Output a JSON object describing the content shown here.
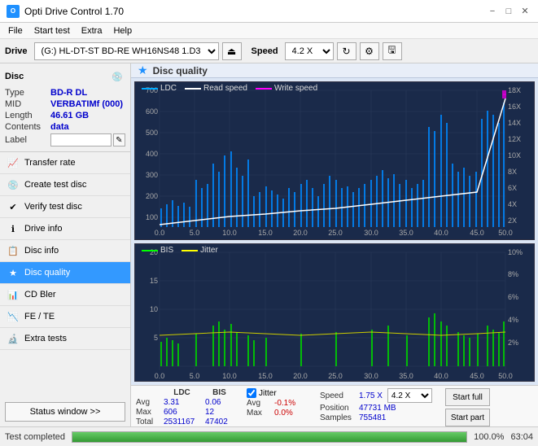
{
  "titlebar": {
    "title": "Opti Drive Control 1.70",
    "icon": "O",
    "minimize": "−",
    "maximize": "□",
    "close": "✕"
  },
  "menubar": {
    "items": [
      "File",
      "Start test",
      "Extra",
      "Help"
    ]
  },
  "drivebar": {
    "label": "Drive",
    "drive_value": "(G:)  HL-DT-ST BD-RE  WH16NS48 1.D3",
    "speed_label": "Speed",
    "speed_value": "4.2 X",
    "eject_icon": "⏏"
  },
  "disc": {
    "title": "Disc",
    "type_label": "Type",
    "type_value": "BD-R DL",
    "mid_label": "MID",
    "mid_value": "VERBATIMf (000)",
    "length_label": "Length",
    "length_value": "46.61 GB",
    "contents_label": "Contents",
    "contents_value": "data",
    "label_label": "Label",
    "label_value": ""
  },
  "nav": {
    "items": [
      {
        "id": "transfer-rate",
        "label": "Transfer rate",
        "icon": "📈"
      },
      {
        "id": "create-test-disc",
        "label": "Create test disc",
        "icon": "💿"
      },
      {
        "id": "verify-test-disc",
        "label": "Verify test disc",
        "icon": "✔"
      },
      {
        "id": "drive-info",
        "label": "Drive info",
        "icon": "ℹ"
      },
      {
        "id": "disc-info",
        "label": "Disc info",
        "icon": "📋"
      },
      {
        "id": "disc-quality",
        "label": "Disc quality",
        "icon": "★",
        "active": true
      },
      {
        "id": "cd-bler",
        "label": "CD Bler",
        "icon": "📊"
      },
      {
        "id": "fe-te",
        "label": "FE / TE",
        "icon": "📉"
      },
      {
        "id": "extra-tests",
        "label": "Extra tests",
        "icon": "🔬"
      }
    ],
    "status_btn": "Status window >>"
  },
  "content": {
    "header": "Disc quality",
    "header_icon": "★"
  },
  "chart_top": {
    "legend": [
      {
        "label": "LDC",
        "color": "#00aaff"
      },
      {
        "label": "Read speed",
        "color": "#ffffff"
      },
      {
        "label": "Write speed",
        "color": "#ff00ff"
      }
    ],
    "y_max": 700,
    "y_min": 0,
    "y_right_max": 18,
    "x_max": 50,
    "y_labels": [
      "700",
      "600",
      "500",
      "400",
      "300",
      "200",
      "100"
    ],
    "y_right_labels": [
      "18X",
      "16X",
      "14X",
      "12X",
      "10X",
      "8X",
      "6X",
      "4X",
      "2X"
    ],
    "x_labels": [
      "0.0",
      "5.0",
      "10.0",
      "15.0",
      "20.0",
      "25.0",
      "30.0",
      "35.0",
      "40.0",
      "45.0",
      "50.0"
    ]
  },
  "chart_bottom": {
    "legend": [
      {
        "label": "BIS",
        "color": "#00ff00"
      },
      {
        "label": "Jitter",
        "color": "#ffff00"
      }
    ],
    "y_max": 20,
    "y_min": 0,
    "y_right_max": 10,
    "x_max": 50,
    "y_labels": [
      "20",
      "15",
      "10",
      "5"
    ],
    "y_right_labels": [
      "10%",
      "8%",
      "6%",
      "4%",
      "2%"
    ],
    "x_labels": [
      "0.0",
      "5.0",
      "10.0",
      "15.0",
      "20.0",
      "25.0",
      "30.0",
      "35.0",
      "40.0",
      "45.0",
      "50.0"
    ]
  },
  "stats": {
    "ldc_label": "LDC",
    "bis_label": "BIS",
    "jitter_label": "Jitter",
    "jitter_checked": true,
    "avg_label": "Avg",
    "avg_ldc": "3.31",
    "avg_bis": "0.06",
    "avg_jitter": "-0.1%",
    "max_label": "Max",
    "max_ldc": "606",
    "max_bis": "12",
    "max_jitter": "0.0%",
    "total_label": "Total",
    "total_ldc": "2531167",
    "total_bis": "47402",
    "speed_label": "Speed",
    "speed_value": "1.75 X",
    "speed_select": "4.2 X",
    "position_label": "Position",
    "position_value": "47731 MB",
    "samples_label": "Samples",
    "samples_value": "755481",
    "start_full_btn": "Start full",
    "start_part_btn": "Start part"
  },
  "statusbar": {
    "text": "Test completed",
    "progress": 100,
    "progress_label": "100.0%",
    "time": "63:04"
  }
}
